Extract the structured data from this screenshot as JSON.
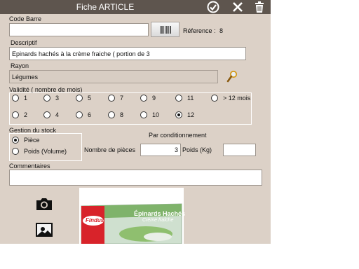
{
  "header": {
    "title": "Fiche ARTICLE"
  },
  "code_barre": {
    "label": "Code Barre",
    "value": "",
    "reference_label": "Réference :",
    "reference_value": "8"
  },
  "descriptif": {
    "label": "Descriptif",
    "value": "Epinards hachés à la crème fraiche ( portion de 3"
  },
  "rayon": {
    "label": "Rayon",
    "value": "Légumes"
  },
  "validite": {
    "label": "Validité ( nombre de mois)",
    "row1": [
      "1",
      "3",
      "5",
      "7",
      "9",
      "11",
      "> 12 mois"
    ],
    "row2": [
      "2",
      "4",
      "6",
      "8",
      "10",
      "12"
    ],
    "selected": "12"
  },
  "stock": {
    "label": "Gestion du stock",
    "option1": "Pièce",
    "option2": "Poids (Volume)",
    "selected": "Pièce"
  },
  "conditionnement": {
    "label": "Par conditionnement",
    "pieces_label": "Nombre de pièces",
    "pieces_value": "3",
    "poids_label": "Poids (Kg)",
    "poids_value": ""
  },
  "commentaires": {
    "label": "Commentaires",
    "value": ""
  },
  "product_image": {
    "brand": "Findus",
    "name_line1": "Épinards Hachés",
    "name_line2": "Crème fraîche"
  }
}
